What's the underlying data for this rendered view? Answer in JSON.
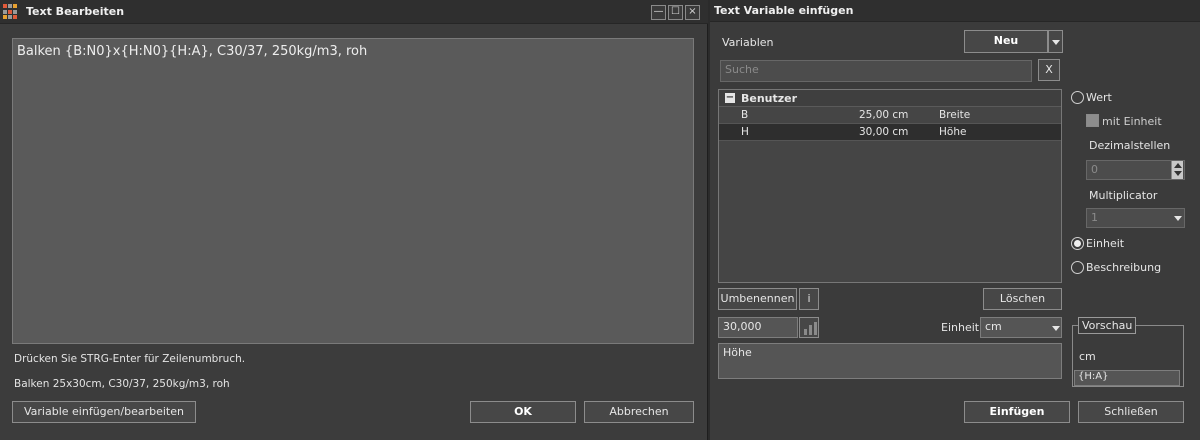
{
  "left_window": {
    "title": "Text Bearbeiten",
    "controls": {
      "minimize": "—",
      "maximize": "☐",
      "close": "×"
    },
    "editor_value": "Balken {B:N0}x{H:N0}{H:A}, C30/37, 250kg/m3,  roh",
    "hint": "Drücken Sie STRG-Enter für Zeilenumbruch.",
    "preview": "Balken 25x30cm, C30/37, 250kg/m3,  roh",
    "buttons": {
      "insert_edit": "Variable einfügen/bearbeiten",
      "ok": "OK",
      "cancel": "Abbrechen"
    }
  },
  "right_window": {
    "title": "Text Variable einfügen",
    "variables_label": "Variablen",
    "new_button": "Neu",
    "search": {
      "placeholder": "Suche",
      "clear": "X"
    },
    "group": {
      "name": "Benutzer",
      "toggle": "−"
    },
    "rows": [
      {
        "name": "B",
        "value": "25,00 cm",
        "desc": "Breite",
        "selected": false
      },
      {
        "name": "H",
        "value": "30,00 cm",
        "desc": "Höhe",
        "selected": true
      }
    ],
    "options": {
      "wert": "Wert",
      "mit_einheit": "mit Einheit",
      "dezimalstellen": "Dezimalstellen",
      "dezimal_value": "0",
      "multiplicator": "Multiplicator",
      "multiplicator_value": "1",
      "einheit": "Einheit",
      "beschreibung": "Beschreibung",
      "selected": "einheit"
    },
    "rename_button": "Umbenennen",
    "info_button": "i",
    "delete_button": "Löschen",
    "value_field": "30,000",
    "unit_label": "Einheit",
    "unit_value": "cm",
    "description_value": "Höhe",
    "preview": {
      "legend": "Vorschau",
      "unit": "cm",
      "code": "{H:A}"
    },
    "insert_button": "Einfügen",
    "close_button": "Schließen"
  }
}
